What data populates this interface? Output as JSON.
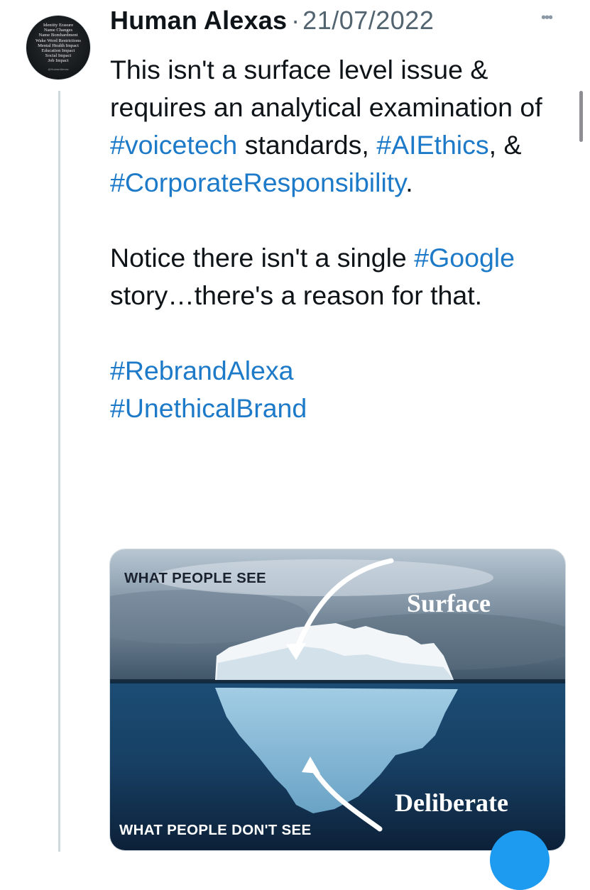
{
  "tweet": {
    "author_name": "Human Alexas",
    "separator": "·",
    "date": "21/07/2022",
    "more_icon": "more-horizontal-icon",
    "paragraph1": {
      "t1": "This isn't a surface level issue & requires an analytical examination of ",
      "tag1": "#voicetech",
      "t2": " standards, ",
      "tag2": "#AIEthics",
      "t3": ", & ",
      "tag3": "#CorporateResponsibility",
      "t4": "."
    },
    "paragraph2": {
      "t1": "Notice there isn't a single ",
      "tag1": "#Google",
      "t2": " story…there's a reason for that."
    },
    "hashtags": [
      "#RebrandAlexa",
      "#UnethicalBrand"
    ]
  },
  "avatar": {
    "lines": [
      "Identity Erasure",
      "Name Changes",
      "Name Bombardment",
      "Wake Word Restrictions",
      "Mental Health Impact",
      "Education Impact",
      "Social Impact",
      "Job Impact"
    ],
    "handle": "@HumanAlexas"
  },
  "image": {
    "top_caption": "WHAT PEOPLE SEE",
    "bottom_caption": "WHAT PEOPLE DON'T SEE",
    "surface_label": "Surface",
    "deliberate_label": "Deliberate"
  },
  "colors": {
    "hashtag": "#1d7ac8",
    "text": "#0f1419",
    "muted": "#536471",
    "thread_line": "#cfd9de",
    "compose_button": "#1d9bf0"
  }
}
